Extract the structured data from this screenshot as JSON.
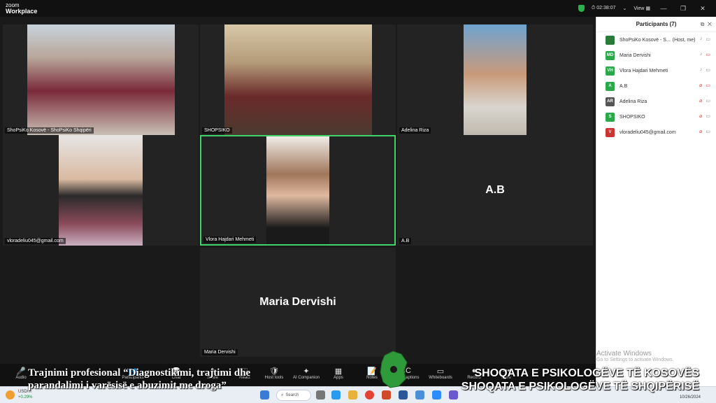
{
  "app": {
    "logo_line1": "zoom",
    "logo_line2": "Workplace"
  },
  "titlebar": {
    "timer": "02:38:07",
    "view_label": "View",
    "min": "—",
    "max": "❐",
    "close": "✕"
  },
  "tiles": [
    {
      "name": "ShoPsiKo Kosovë - ShoPsiKo Shqipëri",
      "kind": "video",
      "bg": "#5a3a3a"
    },
    {
      "name": "SHOPSIKO",
      "kind": "video",
      "bg": "#4a3b2a"
    },
    {
      "name": "Adelina Riza",
      "kind": "video",
      "bg": "#6b7d8c"
    },
    {
      "name": "vloradeliu045@gmail.com",
      "kind": "video",
      "bg": "#d9d9d9"
    },
    {
      "name": "Vlora Hajdari Mehmeti",
      "kind": "video",
      "bg": "#e8e4e0"
    },
    {
      "name": "A.B",
      "kind": "name",
      "bigname": "A.B"
    },
    {
      "name": "Maria Dervishi",
      "kind": "name",
      "bigname": "Maria Dervishi"
    }
  ],
  "participants_panel": {
    "title": "Participants (7)",
    "rows": [
      {
        "initials": "",
        "name": "ShoPsiKo Kosovë - S...",
        "suffix": "(Host, me)",
        "color": "#2a7a3a",
        "mic_muted": false,
        "cam_off": false
      },
      {
        "initials": "MD",
        "name": "Maria Dervishi",
        "suffix": "",
        "color": "#2aa84a",
        "mic_muted": false,
        "cam_off": true
      },
      {
        "initials": "VH",
        "name": "Vlora Hajdari Mehmeti",
        "suffix": "",
        "color": "#2aa84a",
        "mic_muted": false,
        "cam_off": false
      },
      {
        "initials": "A",
        "name": "A.B",
        "suffix": "",
        "color": "#2aa84a",
        "mic_muted": true,
        "cam_off": true
      },
      {
        "initials": "AR",
        "name": "Adelina Riza",
        "suffix": "",
        "color": "#555555",
        "mic_muted": true,
        "cam_off": false
      },
      {
        "initials": "S",
        "name": "SHOPSIKO",
        "suffix": "",
        "color": "#2aa84a",
        "mic_muted": true,
        "cam_off": false
      },
      {
        "initials": "V",
        "name": "vloradeliu045@gmail.com",
        "suffix": "",
        "color": "#cc3333",
        "mic_muted": true,
        "cam_off": false
      }
    ]
  },
  "watermark": {
    "title": "Activate Windows",
    "sub": "Go to Settings to activate Windows."
  },
  "toolbar": {
    "buttons": [
      {
        "label": "Audio",
        "icon": "🎤"
      },
      {
        "label": "Participants",
        "icon": "👥"
      },
      {
        "label": "Chat",
        "icon": "💬"
      },
      {
        "label": "Share",
        "icon": "⬆"
      },
      {
        "label": "React",
        "icon": "♡"
      },
      {
        "label": "Host tools",
        "icon": "🛡"
      },
      {
        "label": "AI Companion",
        "icon": "✦"
      },
      {
        "label": "Apps",
        "icon": "▦"
      },
      {
        "label": "Notes",
        "icon": "📝"
      },
      {
        "label": "Show captions",
        "icon": "CC"
      },
      {
        "label": "Whiteboards",
        "icon": "▭"
      },
      {
        "label": "Record",
        "icon": "●"
      },
      {
        "label": "More",
        "icon": "•••"
      }
    ]
  },
  "captions": {
    "left_line1": "Trajnimi profesional “Diagnostikimi, trajtimi dhe",
    "left_line2": "parandalimi i varësisë e abuzimit me droga”",
    "right_line1": "SHOQATA E PSIKOLOGËVE TË KOSOVËS",
    "right_line2": "SHOQATA E PSIKOLOGËVE TË SHQIPËRISË"
  },
  "taskbar": {
    "weather_label": "USD/...",
    "weather_change": "+0.29%",
    "search_label": "Search",
    "date": "10/26/2024"
  }
}
